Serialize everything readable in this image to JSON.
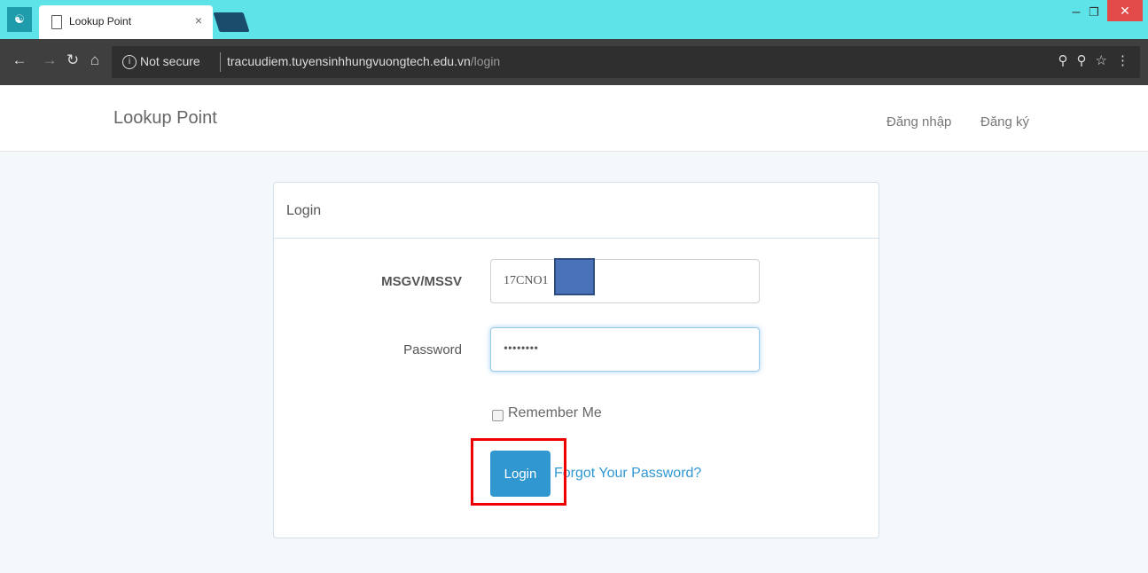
{
  "browser": {
    "tab_title": "Lookup Point",
    "tab_close": "×",
    "security_label": "Not secure",
    "url_host": "tracuudiem.tuyensinhhungvuongtech.edu.vn",
    "url_path": "/login"
  },
  "header": {
    "brand": "Lookup Point",
    "nav": [
      "Đăng nhập",
      "Đăng ký"
    ]
  },
  "login": {
    "card_title": "Login",
    "msgv_label": "MSGV/MSSV",
    "msgv_value": "17CNO1",
    "password_label": "Password",
    "password_value": "••••••••",
    "remember_label": "Remember Me",
    "submit_label": "Login",
    "forgot_label": "Forgot Your Password?"
  },
  "colors": {
    "accent": "#3097d1",
    "tabstrip": "#5ee3e9",
    "highlight": "#e00000"
  }
}
